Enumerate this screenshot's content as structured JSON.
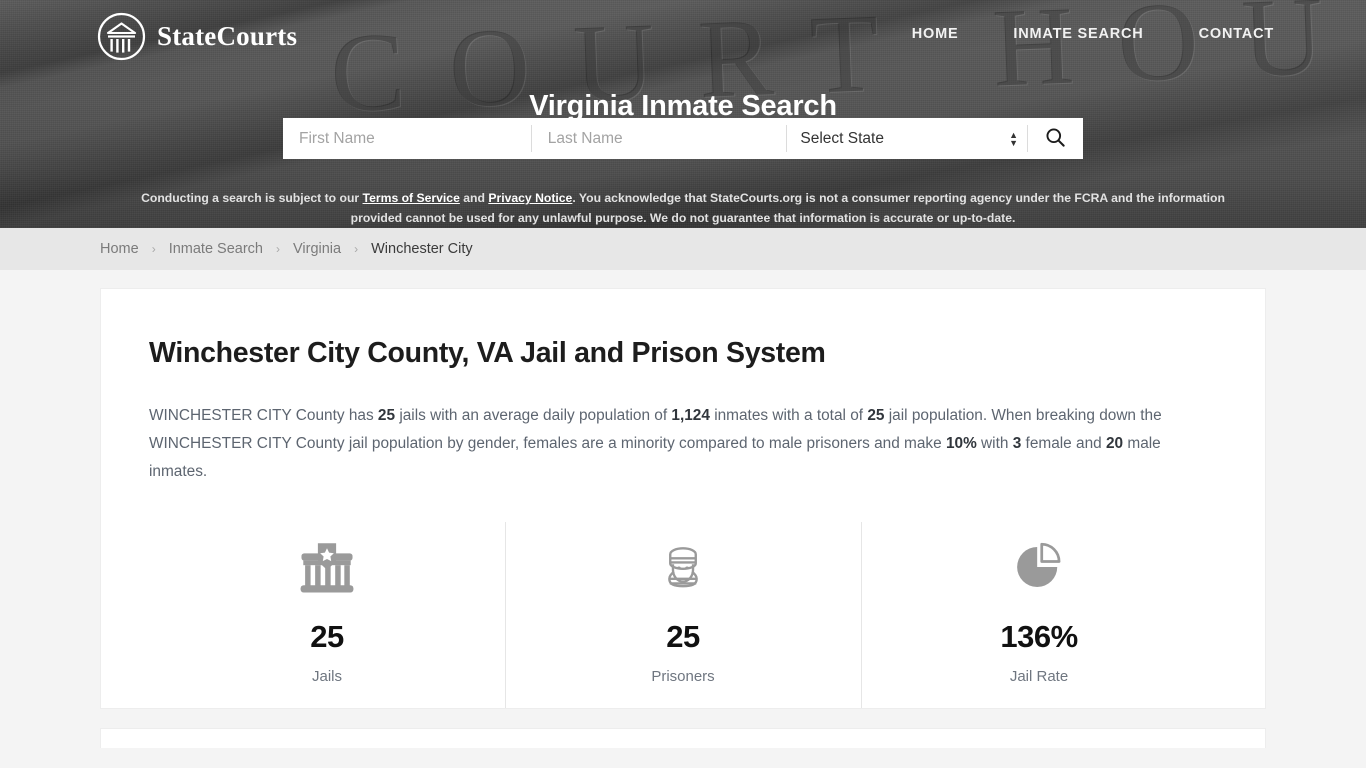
{
  "header": {
    "logo_text": "StateCourts",
    "logo_icon": "courthouse-circle-icon",
    "background_engraving": "COURT HOUSE",
    "nav": [
      {
        "label": "HOME"
      },
      {
        "label": "INMATE SEARCH"
      },
      {
        "label": "CONTACT"
      }
    ],
    "hero_title": "Virginia Inmate Search",
    "search": {
      "first_name_placeholder": "First Name",
      "first_name_value": "",
      "last_name_placeholder": "Last Name",
      "last_name_value": "",
      "state_selected": "Select State",
      "state_options": [
        "Select State"
      ],
      "search_icon": "magnifier-icon"
    },
    "disclaimer": {
      "part1": "Conducting a search is subject to our ",
      "link1": "Terms of Service",
      "part2": " and ",
      "link2": "Privacy Notice",
      "part3": ". You acknowledge that StateCourts.org is not a consumer reporting agency under the FCRA and the information provided cannot be used for any unlawful purpose. We do not guarantee that information is accurate or up-to-date."
    }
  },
  "breadcrumb": {
    "items": [
      {
        "label": "Home",
        "current": false
      },
      {
        "label": "Inmate Search",
        "current": false
      },
      {
        "label": "Virginia",
        "current": false
      },
      {
        "label": "Winchester City",
        "current": true
      }
    ],
    "separator": "›"
  },
  "main": {
    "title": "Winchester City County, VA Jail and Prison System",
    "paragraph": {
      "s1": "WINCHESTER CITY County has ",
      "b1": "25",
      "s2": " jails with an average daily population of ",
      "b2": "1,124",
      "s3": " inmates with a total of ",
      "b3": "25",
      "s4": " jail population. When breaking down the WINCHESTER CITY County jail population by gender, females are a minority compared to male prisoners and make ",
      "b4": "10%",
      "s5": " with ",
      "b5": "3",
      "s6": " female and ",
      "b6": "20",
      "s7": " male inmates."
    },
    "stats": [
      {
        "icon": "jail-building-icon",
        "value": "25",
        "label": "Jails"
      },
      {
        "icon": "prisoner-icon",
        "value": "25",
        "label": "Prisoners"
      },
      {
        "icon": "pie-chart-icon",
        "value": "136%",
        "label": "Jail Rate"
      }
    ]
  },
  "colors": {
    "page_bg": "#f4f4f4",
    "header_bg": "#4e4e4e",
    "breadcrumb_bg": "#e7e7e7",
    "card_bg": "#ffffff",
    "icon_gray": "#9a9a9a",
    "text_dark": "#111111",
    "text_body": "#5d6570"
  }
}
